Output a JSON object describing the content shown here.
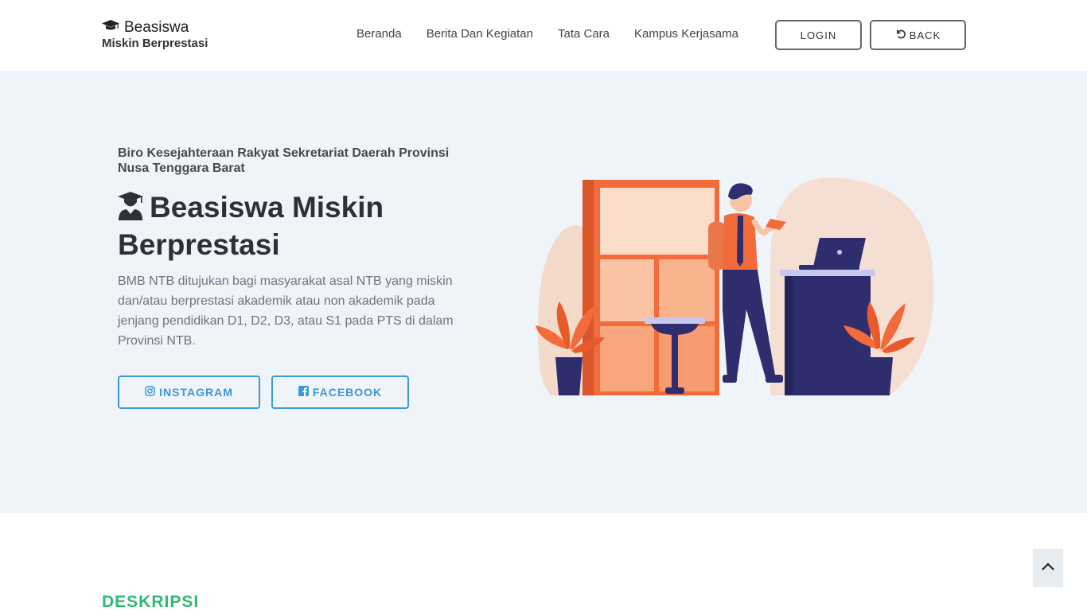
{
  "brand": {
    "line1": "Beasiswa",
    "line2": "Miskin Berprestasi",
    "icon": "graduation-cap-icon"
  },
  "nav": [
    {
      "label": "Beranda"
    },
    {
      "label": "Berita Dan Kegiatan"
    },
    {
      "label": "Tata Cara"
    },
    {
      "label": "Kampus Kerjasama"
    }
  ],
  "buttons": {
    "login": "LOGIN",
    "back": "BACK",
    "back_icon": "undo-icon"
  },
  "hero": {
    "subtitle": "Biro Kesejahteraan Rakyat Sekretariat Daerah Provinsi Nusa Tenggara Barat",
    "title": "Beasiswa Miskin Berprestasi",
    "title_icon": "user-graduate-icon",
    "description": "BMB NTB ditujukan bagi masyarakat asal NTB yang miskin dan/atau berprestasi akademik atau non akademik pada jenjang pendidikan D1, D2, D3, atau S1 pada PTS di dalam Provinsi NTB.",
    "instagram": "INSTAGRAM",
    "facebook": "FACEBOOK"
  },
  "section": {
    "title": "DESKRIPSI"
  },
  "colors": {
    "accent_blue": "#3a9ad9",
    "accent_green": "#2eb872",
    "hero_bg": "#eff4f8",
    "orange": "#f26b3a",
    "navy": "#2e2e6e"
  }
}
